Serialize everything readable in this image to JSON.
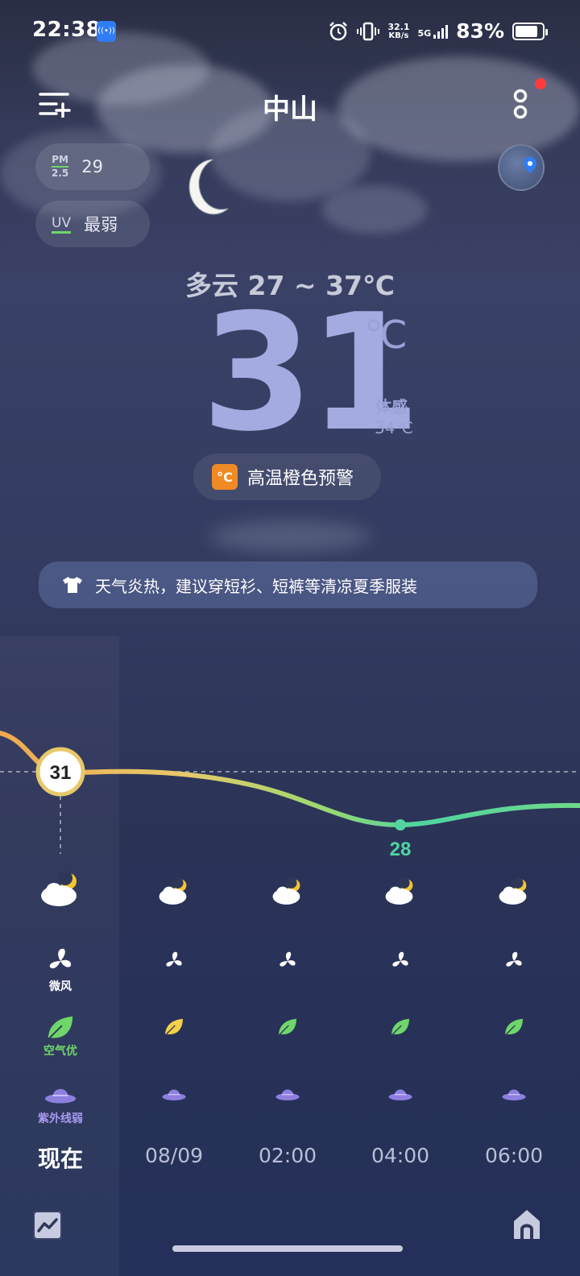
{
  "status_bar": {
    "time": "22:38",
    "net_speed_value": "32.1",
    "net_speed_unit": "KB/s",
    "network_type": "5G",
    "battery": "83%",
    "battery_level": 0.83
  },
  "header": {
    "city": "中山"
  },
  "air": {
    "pm_label_top": "PM",
    "pm_label_bottom": "2.5",
    "pm_value": "29",
    "uv_label": "UV",
    "uv_value": "最弱"
  },
  "current": {
    "condition_range": "多云  27 ~ 37℃",
    "temp": "31",
    "unit": "℃",
    "feels_label": "体感",
    "feels_value": "34℃"
  },
  "alert": {
    "icon_text": "°C",
    "text": "高温橙色预警"
  },
  "tip": {
    "text": "天气炎热，建议穿短衫、短裤等清凉夏季服装"
  },
  "hourly": {
    "current_temp_label": "31",
    "min_temp_label": "28",
    "wind_label": "微风",
    "air_label": "空气优",
    "uv_label": "紫外线弱",
    "times": [
      "现在",
      "08/09",
      "02:00",
      "04:00",
      "06:00"
    ]
  },
  "colors": {
    "accent_temp": "#a3abe0",
    "air_good": "#6fd66a",
    "uv_purple": "#8d7fe0",
    "alert_orange": "#f08a24"
  }
}
